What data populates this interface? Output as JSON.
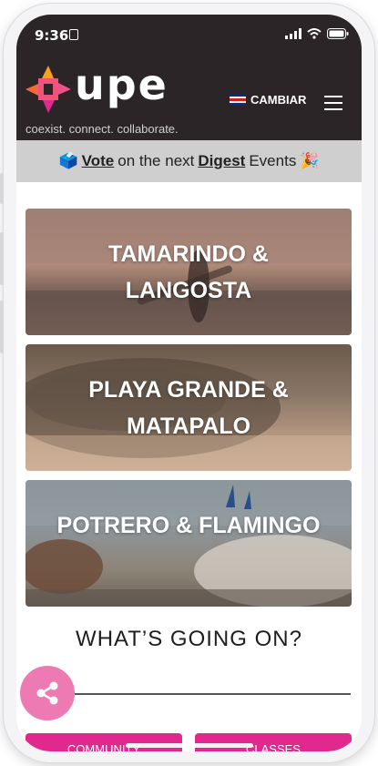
{
  "status": {
    "time": "9:36"
  },
  "header": {
    "logo_text": "upe",
    "tagline": "coexist. connect. collaborate.",
    "language_button": "CAMBIAR"
  },
  "banner": {
    "emoji_left": "🗳️",
    "vote": "Vote",
    "middle": "on the next",
    "digest": "Digest",
    "end": "Events",
    "emoji_right": "🎉"
  },
  "cards": [
    {
      "title": "TAMARINDO & LANGOSTA"
    },
    {
      "title": "PLAYA GRANDE & MATAPALO"
    },
    {
      "title": "POTRERO & FLAMINGO"
    }
  ],
  "section": {
    "title": "WHAT’S GOING ON?"
  },
  "tabs": [
    {
      "label": "COMMUNITY"
    },
    {
      "label": "CLASSES"
    }
  ],
  "colors": {
    "header_bg": "#2b2528",
    "banner_bg": "#cfcfcf",
    "accent_pink": "#e0288e",
    "share_pink": "#ee7ab4"
  }
}
